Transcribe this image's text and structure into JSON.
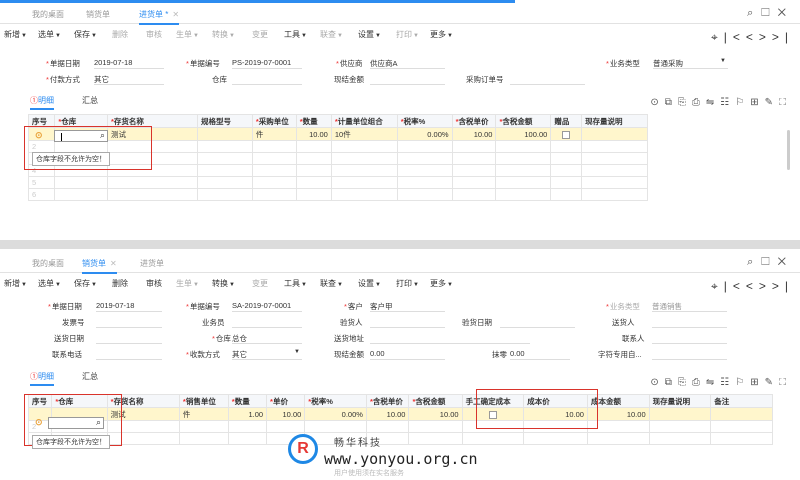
{
  "colors": {
    "accent": "#2d8cf0",
    "highlight_row": "#fff6cc",
    "error_box": "#d9332b"
  },
  "window_controls": [
    "⌕",
    "☐",
    "✕"
  ],
  "nav_icons": [
    "⌖",
    "|<",
    "<",
    ">",
    ">|"
  ],
  "grid_icons": [
    "⊙",
    "⧉",
    "⎘",
    "⎙",
    "⇋",
    "☷",
    "⚐",
    "⊞",
    "✎",
    "⛶"
  ],
  "panel1": {
    "tabs": [
      {
        "label": "我的桌面"
      },
      {
        "label": "销货单"
      },
      {
        "label": "进货单 *"
      }
    ],
    "toolbar": {
      "items": [
        {
          "label": "新增",
          "caret": true,
          "disabled": false
        },
        {
          "label": "选单",
          "caret": true,
          "disabled": false
        },
        {
          "label": "保存",
          "caret": true,
          "disabled": false
        },
        {
          "label": "删除",
          "caret": false,
          "disabled": true
        },
        {
          "label": "审核",
          "caret": false,
          "disabled": true
        },
        {
          "label": "生单",
          "caret": true,
          "disabled": true
        },
        {
          "label": "转换",
          "caret": true,
          "disabled": true
        },
        {
          "label": "变更",
          "caret": false,
          "disabled": true
        },
        {
          "label": "工具",
          "caret": true,
          "disabled": false
        },
        {
          "label": "联查",
          "caret": true,
          "disabled": true
        },
        {
          "label": "设置",
          "caret": true,
          "disabled": false
        },
        {
          "label": "打印",
          "caret": true,
          "disabled": true
        },
        {
          "label": "更多",
          "caret": true,
          "disabled": false
        }
      ]
    },
    "form": {
      "doc_date_label": "单据日期",
      "doc_date": "2019-07-18",
      "doc_no_label": "单据编号",
      "doc_no": "PS-2019-07-0001",
      "supplier_label": "供应商",
      "supplier": "供应商A",
      "biz_type_label": "业务类型",
      "biz_type": "普通采购",
      "pay_method_label": "付款方式",
      "pay_method": "其它",
      "warehouse_label": "仓库",
      "warehouse": "",
      "settle_amount_label": "现结金额",
      "settle_amount": "",
      "po_no_label": "采购订单号",
      "po_no": ""
    },
    "subtabs": {
      "detail": "明细",
      "summary": "汇总",
      "error_mark": "①"
    },
    "grid": {
      "headers": [
        "序号",
        "仓库",
        "存货名称",
        "规格型号",
        "采购单位",
        "数量",
        "计量单位组合",
        "税率%",
        "含税单价",
        "含税金额",
        "赠品",
        "现存量说明"
      ],
      "required": [
        false,
        true,
        true,
        false,
        true,
        true,
        true,
        true,
        true,
        true,
        false,
        false
      ],
      "row": {
        "seq": "",
        "warehouse": "",
        "item": "测试",
        "spec": "",
        "unit": "件",
        "qty": "10.00",
        "unit_combo": "10件",
        "tax": "0.00%",
        "price": "10.00",
        "amount": "100.00",
        "gift": "",
        "stock": ""
      },
      "empty_rows": [
        "2",
        "3",
        "4",
        "5",
        "6"
      ],
      "tooltip": "仓库字段不允许为空！"
    }
  },
  "panel2": {
    "tabs": [
      {
        "label": "我的桌面"
      },
      {
        "label": "销货单"
      },
      {
        "label": "进货单"
      }
    ],
    "toolbar": {
      "items": [
        {
          "label": "新增",
          "caret": true,
          "disabled": false
        },
        {
          "label": "选单",
          "caret": true,
          "disabled": false
        },
        {
          "label": "保存",
          "caret": true,
          "disabled": false
        },
        {
          "label": "删除",
          "caret": false,
          "disabled": false
        },
        {
          "label": "审核",
          "caret": false,
          "disabled": false
        },
        {
          "label": "生单",
          "caret": true,
          "disabled": true
        },
        {
          "label": "转换",
          "caret": true,
          "disabled": false
        },
        {
          "label": "变更",
          "caret": false,
          "disabled": true
        },
        {
          "label": "工具",
          "caret": true,
          "disabled": false
        },
        {
          "label": "联查",
          "caret": true,
          "disabled": false
        },
        {
          "label": "设置",
          "caret": true,
          "disabled": false
        },
        {
          "label": "打印",
          "caret": true,
          "disabled": false
        },
        {
          "label": "更多",
          "caret": true,
          "disabled": false
        }
      ]
    },
    "form": {
      "doc_date_label": "单据日期",
      "doc_date": "2019-07-18",
      "doc_no_label": "单据编号",
      "doc_no": "SA-2019-07-0001",
      "customer_label": "客户",
      "customer": "客户甲",
      "biz_type_label": "业务类型",
      "biz_type": "普通销售",
      "invoice_no_label": "发票号",
      "invoice_no": "",
      "salesperson_label": "业务员",
      "salesperson": "",
      "receiver_label": "验货人",
      "receiver": "",
      "receive_date_label": "验货日期",
      "receive_date": "",
      "shipper_label": "送货人",
      "shipper": "",
      "ship_date_label": "送货日期",
      "ship_date": "",
      "warehouse_label": "仓库",
      "warehouse": "总仓",
      "ship_addr_label": "送货地址",
      "ship_addr": "",
      "contact_label": "联系人",
      "contact": "",
      "phone_label": "联系电话",
      "phone": "",
      "collect_label": "收款方式",
      "collect": "其它",
      "settle_amount_label": "现结金额",
      "settle_amount": "0.00",
      "discount_label": "抹零",
      "discount": "0.00",
      "special_label": "字符专用自...",
      "special": ""
    },
    "subtabs": {
      "detail": "明细",
      "summary": "汇总",
      "error_mark": "①"
    },
    "grid": {
      "headers": [
        "序号",
        "仓库",
        "存货名称",
        "销售单位",
        "数量",
        "单价",
        "税率%",
        "含税单价",
        "含税金额",
        "手工确定成本",
        "成本价",
        "成本金额",
        "现存量说明",
        "备注"
      ],
      "required": [
        false,
        true,
        true,
        true,
        true,
        true,
        true,
        true,
        true,
        false,
        false,
        false,
        false,
        false
      ],
      "row": {
        "seq": "",
        "warehouse": "",
        "item": "测试",
        "unit": "件",
        "qty": "1.00",
        "price": "10.00",
        "tax": "0.00%",
        "tax_price": "10.00",
        "amount": "10.00",
        "manual": "",
        "cost": "10.00",
        "cost_amount": "10.00",
        "stock": "",
        "note": ""
      },
      "empty_rows": [
        "2",
        "3"
      ],
      "tooltip": "仓库字段不允许为空！"
    }
  },
  "watermark": {
    "logo": "R",
    "cn": "畅华科技",
    "url": "www.yonyou.org.cn",
    "faded": "用户使用须在实名服务"
  }
}
